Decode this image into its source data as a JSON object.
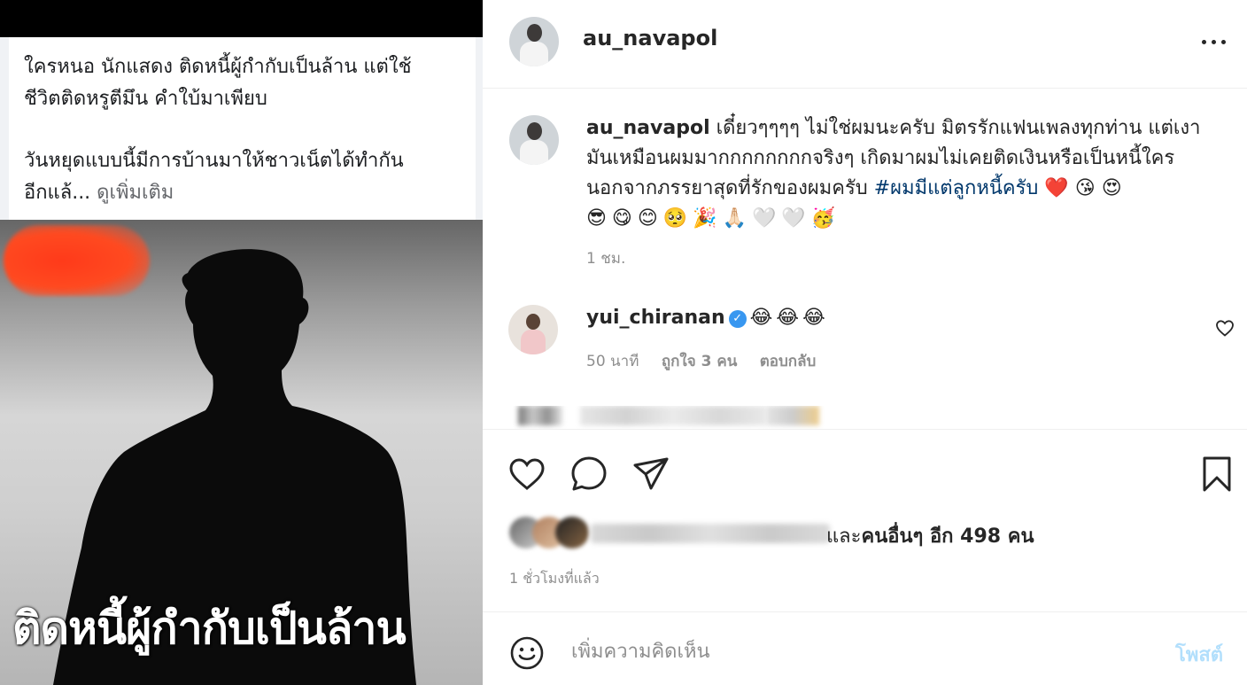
{
  "fb_post": {
    "line1": "ใครหนอ นักแสดง ติดหนี้ผู้กำกับเป็นล้าน แต่ใช้",
    "line2": "ชีวิตติดหรูตีมึน คำใบ้มาเพียบ",
    "line3": "วันหยุดแบบนี้มีการบ้านมาให้ชาวเน็ตได้ทำกัน",
    "line4_start": "อีกแล้... ",
    "see_more": "ดูเพิ่มเติม"
  },
  "photo": {
    "caption": "ติดหนี้ผู้กำกับเป็นล้าน"
  },
  "header": {
    "username": "au_navapol",
    "more_icon": "more-horizontal-icon"
  },
  "caption": {
    "username": "au_navapol",
    "text": " เดี๋ยวๆๆๆๆ ไม่ใช่ผมนะครับ มิตรรักแฟนเพลงทุกท่าน แต่เงามันเหมือนผมมากกกกกกกกจริงๆ เกิดมาผมไม่เคยติดเงินหรือเป็นหนี้ใคร นอกจากภรรยาสุดที่รักของผมครับ ",
    "hashtag": "#ผมมีแต่ลูกหนี้ครับ",
    "emojis_1": " ❤️ 😘 😍",
    "emojis_2": "😎😋😊🥺🎉🙏🏻🤍🤍🥳",
    "time": "1 ชม."
  },
  "comment": {
    "username": "yui_chiranan",
    "verified": "✓",
    "text": "😂😂😂",
    "time": "50 นาที",
    "likes": "ถูกใจ 3 คน",
    "reply": "ตอบกลับ"
  },
  "actions": {
    "like_icon": "heart-icon",
    "comment_icon": "comment-icon",
    "share_icon": "send-icon",
    "save_icon": "bookmark-icon"
  },
  "likes": {
    "prefix": "และ",
    "others": "คนอื่นๆ อีก 498 คน"
  },
  "post_time": "1 ชั่วโมงที่แล้ว",
  "composer": {
    "placeholder": "เพิ่มความคิดเห็น",
    "post_label": "โพสต์"
  },
  "colors": {
    "link": "#00376b",
    "post_button": "#b2dffc",
    "verified": "#3897f0",
    "muted": "#8e8e8e"
  }
}
